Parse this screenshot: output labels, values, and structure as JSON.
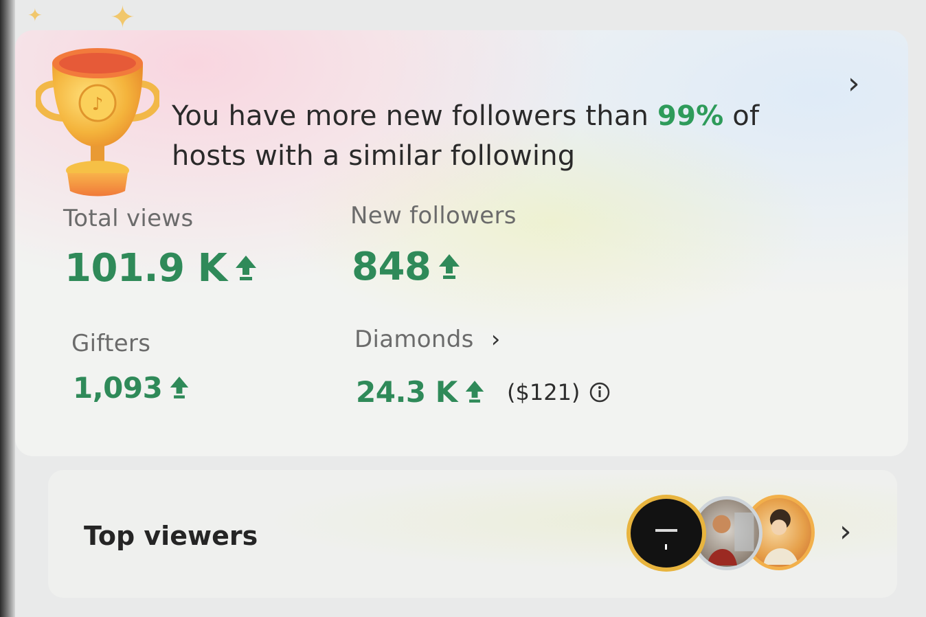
{
  "banner": {
    "text_before": "You have more new followers than ",
    "percent": "99%",
    "text_after": " of hosts with a similar following"
  },
  "stats": {
    "total_views": {
      "label": "Total views",
      "value": "101.9 K"
    },
    "new_followers": {
      "label": "New followers",
      "value": "848"
    },
    "gifters": {
      "label": "Gifters",
      "value": "1,093"
    },
    "diamonds": {
      "label": "Diamonds",
      "value": "24.3 K",
      "usd": "($121)"
    }
  },
  "top_viewers": {
    "title": "Top viewers",
    "avatars": [
      "viewer-avatar-1",
      "viewer-avatar-2",
      "viewer-avatar-3"
    ]
  },
  "colors": {
    "positive": "#2f8a59",
    "percent": "#2e9b5a"
  },
  "icons": [
    "trophy-icon",
    "chevron-right-icon",
    "up-arrow-icon",
    "info-icon"
  ]
}
